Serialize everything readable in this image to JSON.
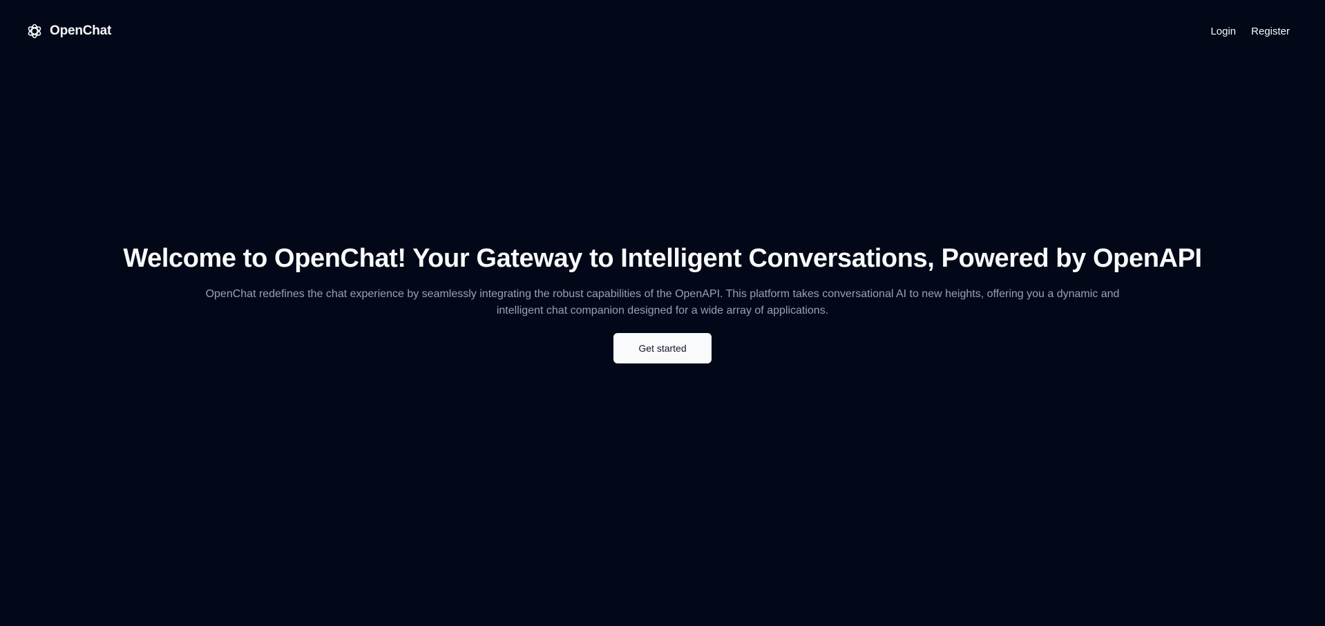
{
  "header": {
    "brand": {
      "name": "OpenChat",
      "icon": "openai-logo-icon"
    },
    "nav": [
      {
        "label": "Login"
      },
      {
        "label": "Register"
      }
    ]
  },
  "hero": {
    "title": "Welcome to OpenChat! Your Gateway to Intelligent Conversations, Powered by OpenAPI",
    "description": "OpenChat redefines the chat experience by seamlessly integrating the robust capabilities of the OpenAPI. This platform takes conversational AI to new heights, offering you a dynamic and intelligent chat companion designed for a wide array of applications.",
    "cta_label": "Get started"
  },
  "colors": {
    "background": "#020817",
    "text": "#f8fafc",
    "muted_text": "#94a3b8",
    "button_bg": "#f8fafc",
    "button_text": "#0f172a"
  }
}
